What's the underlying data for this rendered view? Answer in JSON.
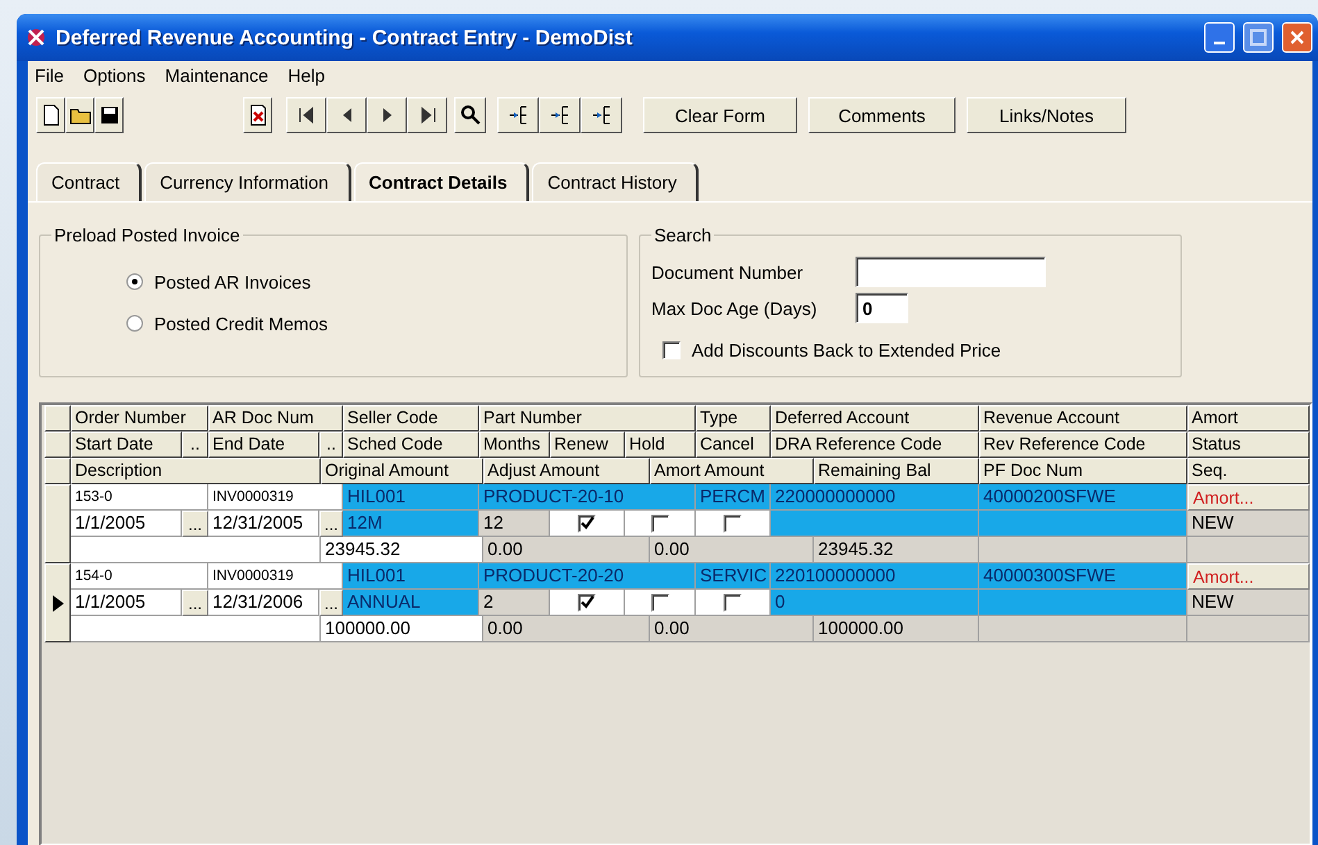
{
  "window": {
    "title": "Deferred Revenue Accounting - Contract Entry - DemoDist"
  },
  "menu": [
    "File",
    "Options",
    "Maintenance",
    "Help"
  ],
  "toolbar_buttons": [
    "Clear Form",
    "Comments",
    "Links/Notes"
  ],
  "tabs": [
    {
      "label": "Contract",
      "selected": false
    },
    {
      "label": "Currency Information",
      "selected": false
    },
    {
      "label": "Contract Details",
      "selected": true
    },
    {
      "label": "Contract History",
      "selected": false
    }
  ],
  "preload": {
    "title": "Preload Posted Invoice",
    "options": [
      {
        "label": "Posted AR Invoices",
        "selected": true
      },
      {
        "label": "Posted Credit Memos",
        "selected": false
      }
    ]
  },
  "search": {
    "title": "Search",
    "document_number_label": "Document Number",
    "max_doc_age_label": "Max Doc Age (Days)",
    "max_doc_age": "0",
    "add_discounts_label": "Add Discounts Back to Extended Price",
    "add_discounts": false
  },
  "grid": {
    "header_rows": [
      [
        "Order Number",
        "AR Doc Num",
        "Seller Code",
        "Part Number",
        "Type",
        "Deferred Account",
        "Revenue Account",
        "Amort"
      ],
      [
        "Start Date",
        "..",
        "End Date",
        "..",
        "Sched Code",
        "Months",
        "Renew",
        "Hold",
        "Cancel",
        "DRA Reference Code",
        "Rev Reference Code",
        "Status"
      ],
      [
        "Description",
        "Original Amount",
        "Adjust Amount",
        "Amort Amount",
        "Remaining Bal",
        "PF Doc Num",
        "Seq."
      ]
    ],
    "records": [
      {
        "selected": false,
        "order_number": "153-0",
        "ar_doc_num": "INV0000319",
        "seller_code": "HIL001",
        "part_number": "PRODUCT-20-10",
        "type": "PERCM",
        "deferred_account": "220000000000",
        "revenue_account": "40000200SFWE",
        "amort_button": "Amort...",
        "start_date": "1/1/2005",
        "start_button": "...",
        "end_date": "12/31/2005",
        "end_button": "...",
        "sched_code": "12M",
        "months": "12",
        "renew": true,
        "hold": false,
        "cancel": false,
        "status": "NEW",
        "original_amount": "23945.32",
        "adjust_amount": "0.00",
        "amort_amount": "0.00",
        "remaining_bal": "23945.32"
      },
      {
        "selected": true,
        "order_number": "154-0",
        "ar_doc_num": "INV0000319",
        "seller_code": "HIL001",
        "part_number": "PRODUCT-20-20",
        "type": "SERVIC",
        "deferred_account": "220100000000",
        "revenue_account": "40000300SFWE",
        "amort_button": "Amort...",
        "start_date": "1/1/2005",
        "start_button": "...",
        "end_date": "12/31/2006",
        "end_button": "...",
        "sched_code": "ANNUAL",
        "months": "2",
        "renew": true,
        "hold": false,
        "cancel": false,
        "dra_reference_code": "0",
        "status": "NEW",
        "original_amount": "100000.00",
        "adjust_amount": "0.00",
        "amort_amount": "0.00",
        "remaining_bal": "100000.00"
      }
    ]
  }
}
